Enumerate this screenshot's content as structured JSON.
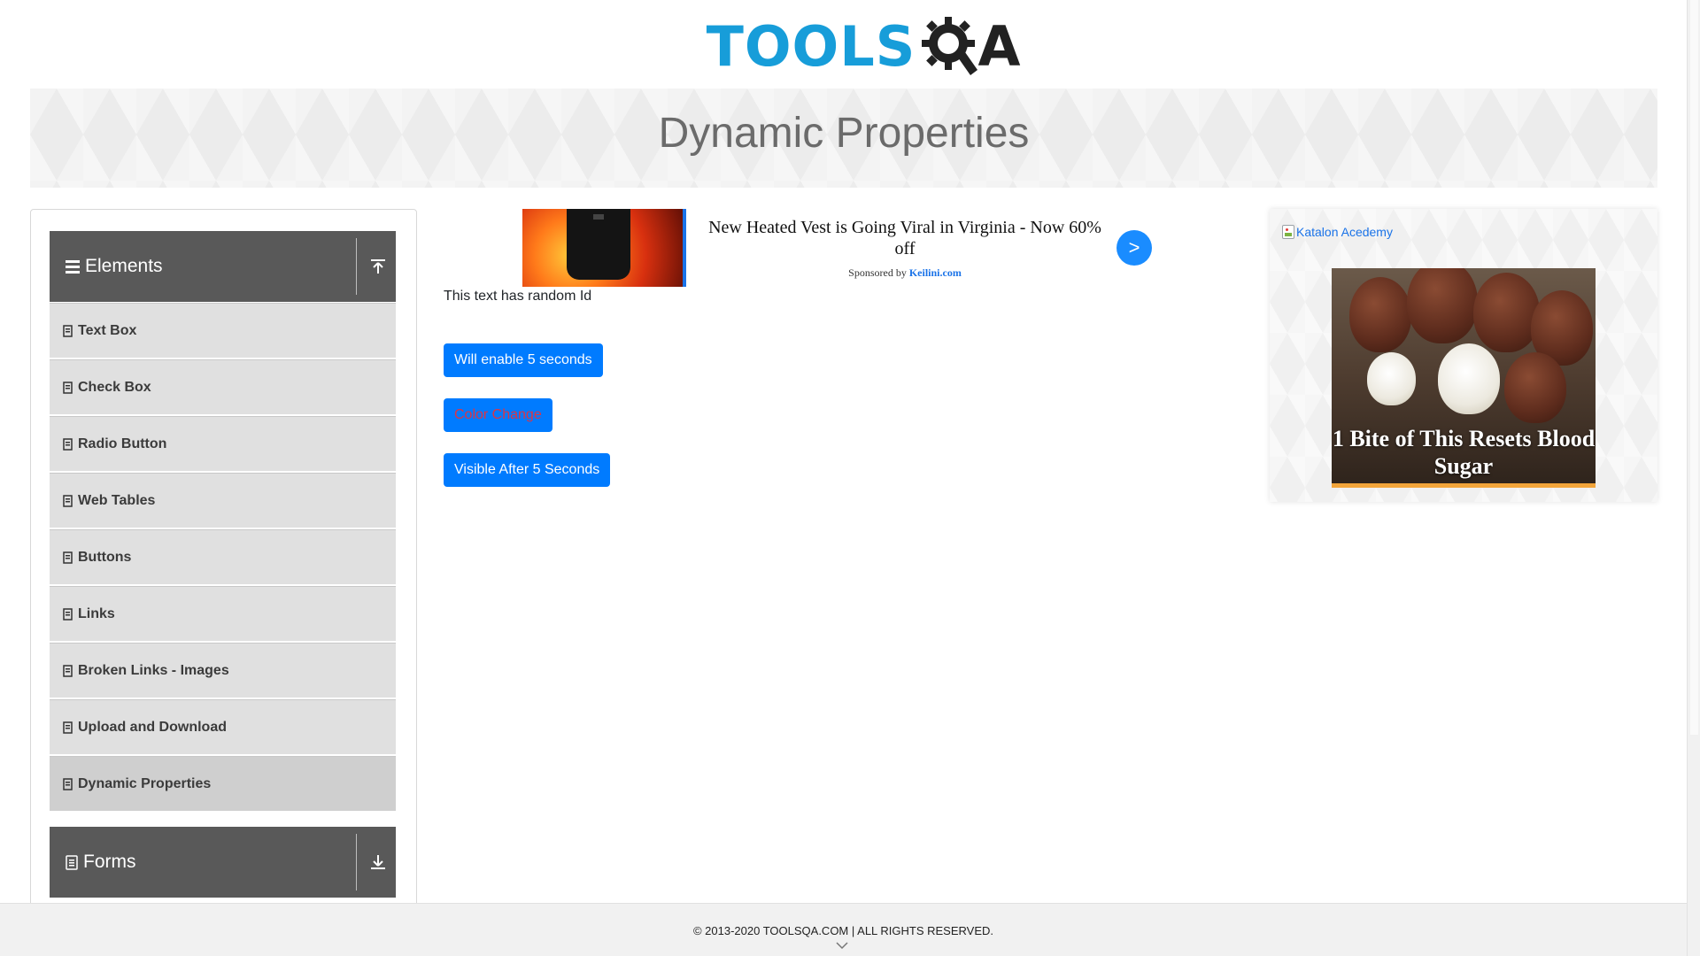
{
  "header": {
    "logo_text": "TOOLS",
    "logo_suffix": "A"
  },
  "banner": {
    "title": "Dynamic Properties"
  },
  "sidebar": {
    "groups": [
      {
        "title": "Elements",
        "expanded": true,
        "icon": "hamburger-icon",
        "toggle_icon": "collapse-up-icon"
      },
      {
        "title": "Forms",
        "expanded": false,
        "icon": "document-icon",
        "toggle_icon": "expand-down-icon"
      }
    ],
    "items": [
      {
        "label": "Text Box",
        "active": false
      },
      {
        "label": "Check Box",
        "active": false
      },
      {
        "label": "Radio Button",
        "active": false
      },
      {
        "label": "Web Tables",
        "active": false
      },
      {
        "label": "Buttons",
        "active": false
      },
      {
        "label": "Links",
        "active": false
      },
      {
        "label": "Broken Links - Images",
        "active": false
      },
      {
        "label": "Upload and Download",
        "active": false
      },
      {
        "label": "Dynamic Properties",
        "active": true
      }
    ]
  },
  "main": {
    "ad": {
      "headline": "New Heated Vest is Going Viral in Virginia - Now 60% off",
      "sponsored_by": "Sponsored by",
      "sponsor": "Keilini.com",
      "go_button": ">"
    },
    "random_text": "This text has random Id",
    "buttons": {
      "enable_after": "Will enable 5 seconds",
      "color_change": "Color Change",
      "visible_after": "Visible After 5 Seconds"
    },
    "colors": {
      "primary": "#007bff",
      "color_change_text": "#dc3545"
    }
  },
  "right_ad": {
    "link_text": "Katalon Acedemy",
    "card_title": "1 Bite of This Resets Blood Sugar"
  },
  "footer": {
    "text": "© 2013-2020 TOOLSQA.COM | ALL RIGHTS RESERVED."
  }
}
